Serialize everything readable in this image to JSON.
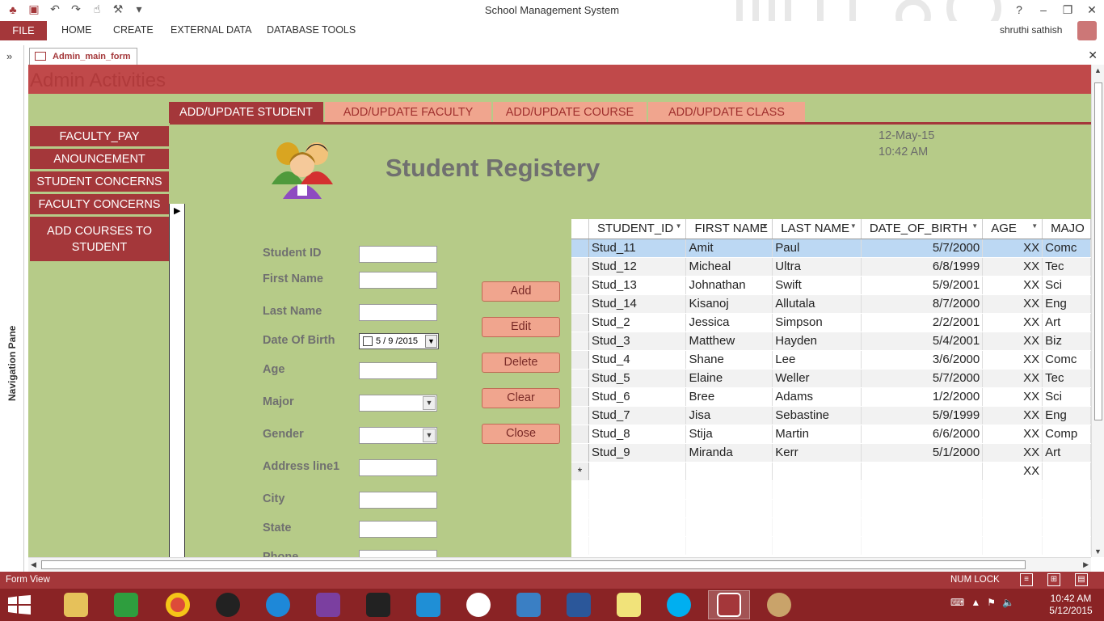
{
  "window": {
    "title": "School Management System"
  },
  "ribbon": {
    "file": "FILE",
    "tabs": [
      "HOME",
      "CREATE",
      "EXTERNAL DATA",
      "DATABASE TOOLS"
    ],
    "user": "shruthi sathish"
  },
  "nav_pane": {
    "label": "Navigation Pane",
    "toggle": "»"
  },
  "document_tab": {
    "label": "Admin_main_form"
  },
  "form": {
    "header": "Admin Activities",
    "tabs": [
      "ADD/UPDATE STUDENT",
      "ADD/UPDATE FACULTY",
      "ADD/UPDATE COURSE",
      "ADD/UPDATE CLASS"
    ],
    "side_buttons": [
      "FACULTY_PAY",
      "ANOUNCEMENT",
      "STUDENT CONCERNS",
      "FACULTY CONCERNS",
      "ADD COURSES TO STUDENT"
    ],
    "date": "12-May-15",
    "time": "10:42 AM",
    "title": "Student Registery",
    "fields": {
      "student_id": "Student ID",
      "first_name": "First Name",
      "last_name": "Last Name",
      "dob": "Date Of Birth",
      "dob_value": "5 / 9 /2015",
      "age": "Age",
      "major": "Major",
      "gender": "Gender",
      "address1": "Address line1",
      "city": "City",
      "state": "State",
      "phone": "Phone"
    },
    "buttons": {
      "add": "Add",
      "edit": "Edit",
      "delete": "Delete",
      "clear": "Clear",
      "close": "Close"
    }
  },
  "datasheet": {
    "columns": [
      "STUDENT_ID",
      "FIRST NAME",
      "LAST NAME",
      "DATE_OF_BIRTH",
      "AGE",
      "MAJO"
    ],
    "rows": [
      [
        "Stud_11",
        "Amit",
        "Paul",
        "5/7/2000",
        "XX",
        "Comc"
      ],
      [
        "Stud_12",
        "Micheal",
        "Ultra",
        "6/8/1999",
        "XX",
        "Tec"
      ],
      [
        "Stud_13",
        "Johnathan",
        "Swift",
        "5/9/2001",
        "XX",
        "Sci"
      ],
      [
        "Stud_14",
        "Kisanoj",
        "Allutala",
        "8/7/2000",
        "XX",
        "Eng"
      ],
      [
        "Stud_2",
        "Jessica",
        "Simpson",
        "2/2/2001",
        "XX",
        "Art"
      ],
      [
        "Stud_3",
        "Matthew",
        "Hayden",
        "5/4/2001",
        "XX",
        "Biz"
      ],
      [
        "Stud_4",
        "Shane",
        "Lee",
        "3/6/2000",
        "XX",
        "Comc"
      ],
      [
        "Stud_5",
        "Elaine",
        "Weller",
        "5/7/2000",
        "XX",
        "Tec"
      ],
      [
        "Stud_6",
        "Bree",
        "Adams",
        "1/2/2000",
        "XX",
        "Sci"
      ],
      [
        "Stud_7",
        "Jisa",
        "Sebastine",
        "5/9/1999",
        "XX",
        "Eng"
      ],
      [
        "Stud_8",
        "Stija",
        "Martin",
        "6/6/2000",
        "XX",
        "Comp"
      ],
      [
        "Stud_9",
        "Miranda",
        "Kerr",
        "5/1/2000",
        "XX",
        "Art"
      ]
    ],
    "new_row_marker": "*",
    "new_row_age": "XX"
  },
  "status": {
    "left": "Form View",
    "num_lock": "NUM LOCK"
  },
  "taskbar": {
    "time": "10:42 AM",
    "date": "5/12/2015"
  }
}
